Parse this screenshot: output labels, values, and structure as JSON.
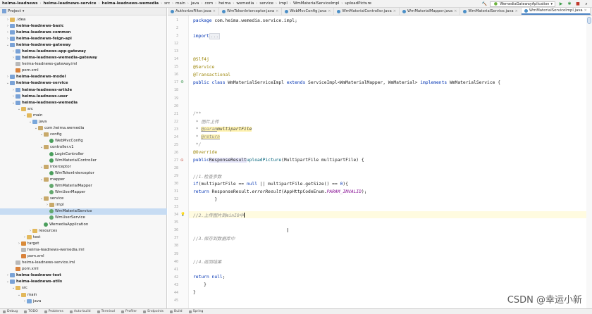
{
  "breadcrumb": [
    "heima-leadnews",
    "heima-leadnews-service",
    "heima-leadnews-wemedia",
    "src",
    "main",
    "java",
    "com",
    "heima",
    "wemedia",
    "service",
    "impl",
    "WmMaterialServiceImpl",
    "uploadPicture"
  ],
  "run_config": "WemediaGatewayAplication",
  "sidebar": {
    "title": "Project",
    "tree": [
      {
        "label": ".idea",
        "indent": 1,
        "arrow": "›",
        "icon": "folder",
        "bold": false
      },
      {
        "label": "heima-leadnews-basic",
        "indent": 1,
        "arrow": "›",
        "icon": "module",
        "bold": true
      },
      {
        "label": "heima-leadnews-common",
        "indent": 1,
        "arrow": "›",
        "icon": "module",
        "bold": true
      },
      {
        "label": "heima-leadnews-feign-api",
        "indent": 1,
        "arrow": "›",
        "icon": "module",
        "bold": true
      },
      {
        "label": "heima-leadnews-gateway",
        "indent": 1,
        "arrow": "⌄",
        "icon": "module",
        "bold": true
      },
      {
        "label": "heima-leadnews-app-gateway",
        "indent": 2,
        "arrow": "›",
        "icon": "module",
        "bold": true
      },
      {
        "label": "heima-leadnews-wemedia-gateway",
        "indent": 2,
        "arrow": "›",
        "icon": "module",
        "bold": true
      },
      {
        "label": "heima-leadnews-gateway.iml",
        "indent": 2,
        "arrow": "",
        "icon": "file",
        "bold": false
      },
      {
        "label": "pom.xml",
        "indent": 2,
        "arrow": "",
        "icon": "xml",
        "bold": false
      },
      {
        "label": "heima-leadnews-model",
        "indent": 1,
        "arrow": "›",
        "icon": "module",
        "bold": true
      },
      {
        "label": "heima-leadnews-service",
        "indent": 1,
        "arrow": "⌄",
        "icon": "module",
        "bold": true
      },
      {
        "label": "heima-leadnews-article",
        "indent": 2,
        "arrow": "›",
        "icon": "module",
        "bold": true
      },
      {
        "label": "heima-leadnews-user",
        "indent": 2,
        "arrow": "›",
        "icon": "module",
        "bold": true
      },
      {
        "label": "heima-leadnews-wemedia",
        "indent": 2,
        "arrow": "⌄",
        "icon": "module",
        "bold": true
      },
      {
        "label": "src",
        "indent": 3,
        "arrow": "⌄",
        "icon": "folder",
        "bold": false
      },
      {
        "label": "main",
        "indent": 4,
        "arrow": "⌄",
        "icon": "folder",
        "bold": false
      },
      {
        "label": "java",
        "indent": 5,
        "arrow": "⌄",
        "icon": "src",
        "bold": false
      },
      {
        "label": "com.heima.wemedia",
        "indent": 6,
        "arrow": "⌄",
        "icon": "pkg",
        "bold": false
      },
      {
        "label": "config",
        "indent": 7,
        "arrow": "⌄",
        "icon": "pkg",
        "bold": false
      },
      {
        "label": "WebMvcConfig",
        "indent": 8,
        "arrow": "",
        "icon": "java",
        "bold": false
      },
      {
        "label": "controller.v1",
        "indent": 7,
        "arrow": "⌄",
        "icon": "pkg",
        "bold": false
      },
      {
        "label": "LoginController",
        "indent": 8,
        "arrow": "",
        "icon": "java",
        "bold": false
      },
      {
        "label": "WmMaterialController",
        "indent": 8,
        "arrow": "",
        "icon": "java",
        "bold": false
      },
      {
        "label": "interceptor",
        "indent": 7,
        "arrow": "⌄",
        "icon": "pkg",
        "bold": false
      },
      {
        "label": "WmTokenInterceptor",
        "indent": 8,
        "arrow": "",
        "icon": "java",
        "bold": false
      },
      {
        "label": "mapper",
        "indent": 7,
        "arrow": "⌄",
        "icon": "pkg",
        "bold": false
      },
      {
        "label": "WmMaterialMapper",
        "indent": 8,
        "arrow": "",
        "icon": "iface",
        "bold": false
      },
      {
        "label": "WmUserMapper",
        "indent": 8,
        "arrow": "",
        "icon": "iface",
        "bold": false
      },
      {
        "label": "service",
        "indent": 7,
        "arrow": "⌄",
        "icon": "pkg",
        "bold": false
      },
      {
        "label": "impl",
        "indent": 8,
        "arrow": "›",
        "icon": "pkg",
        "bold": false
      },
      {
        "label": "WmMaterialService",
        "indent": 8,
        "arrow": "",
        "icon": "iface",
        "bold": false,
        "selected": true
      },
      {
        "label": "WmUserService",
        "indent": 8,
        "arrow": "",
        "icon": "iface",
        "bold": false
      },
      {
        "label": "WemediaApplication",
        "indent": 7,
        "arrow": "",
        "icon": "java",
        "bold": false
      },
      {
        "label": "resources",
        "indent": 5,
        "arrow": "›",
        "icon": "folder",
        "bold": false
      },
      {
        "label": "test",
        "indent": 4,
        "arrow": "›",
        "icon": "folder",
        "bold": false
      },
      {
        "label": "target",
        "indent": 3,
        "arrow": "›",
        "icon": "target",
        "bold": false
      },
      {
        "label": "heima-leadnews-wemedia.iml",
        "indent": 3,
        "arrow": "",
        "icon": "file",
        "bold": false
      },
      {
        "label": "pom.xml",
        "indent": 3,
        "arrow": "",
        "icon": "xml",
        "bold": false
      },
      {
        "label": "heima-leadnews-service.iml",
        "indent": 2,
        "arrow": "",
        "icon": "file",
        "bold": false
      },
      {
        "label": "pom.xml",
        "indent": 2,
        "arrow": "",
        "icon": "xml",
        "bold": false
      },
      {
        "label": "heima-leadnews-test",
        "indent": 1,
        "arrow": "›",
        "icon": "module",
        "bold": true
      },
      {
        "label": "heima-leadnews-utils",
        "indent": 1,
        "arrow": "⌄",
        "icon": "module",
        "bold": true
      },
      {
        "label": "src",
        "indent": 2,
        "arrow": "⌄",
        "icon": "folder",
        "bold": false
      },
      {
        "label": "main",
        "indent": 3,
        "arrow": "⌄",
        "icon": "folder",
        "bold": false
      },
      {
        "label": "java",
        "indent": 4,
        "arrow": "›",
        "icon": "src",
        "bold": false
      }
    ]
  },
  "tabs": [
    {
      "label": "AuthorizeFilter.java",
      "active": false
    },
    {
      "label": "WmTokenInterceptor.java",
      "active": false
    },
    {
      "label": "WebMvcConfig.java",
      "active": false
    },
    {
      "label": "WmMaterialController.java",
      "active": false
    },
    {
      "label": "WmMaterialMapper.java",
      "active": false
    },
    {
      "label": "WmMaterialService.java",
      "active": false
    },
    {
      "label": "WmMaterialServiceImpl.java",
      "active": true
    }
  ],
  "editor": {
    "lines": [
      {
        "n": "1",
        "html": "<span class='kw'>package</span> com.heima.wemedia.service.impl;"
      },
      {
        "n": "2",
        "html": ""
      },
      {
        "n": "3",
        "html": "<span class='kw'>import</span> <span class='fold'>...</span>"
      },
      {
        "n": "12",
        "html": ""
      },
      {
        "n": "13",
        "html": ""
      },
      {
        "n": "14",
        "html": "<span class='ann'>@Slf4j</span>"
      },
      {
        "n": "15",
        "html": "<span class='ann'>@Service</span>"
      },
      {
        "n": "16",
        "html": "<span class='ann'>@Transactional</span>"
      },
      {
        "n": "17",
        "html": "<span class='kw'>public class</span> WmMaterialServiceImpl <span class='kw'>extends</span> ServiceImpl&lt;WmMaterialMapper, WmMaterial&gt; <span class='kw'>implements</span> WmMaterialService {",
        "mark": "⚙",
        "markColor": "#4a9e5c"
      },
      {
        "n": "18",
        "html": ""
      },
      {
        "n": "19",
        "html": ""
      },
      {
        "n": "20",
        "html": ""
      },
      {
        "n": "21",
        "html": "    <span class='doc'>/**</span>"
      },
      {
        "n": "22",
        "html": "    <span class='doc'> * 图片上传</span>"
      },
      {
        "n": "23",
        "html": "    <span class='doc'> * </span><span class='doctag'>@param</span> <span class='docparam'>multipartFile</span>"
      },
      {
        "n": "24",
        "html": "    <span class='doc'> * </span><span class='doctag'>@return</span>"
      },
      {
        "n": "25",
        "html": "    <span class='doc'> */</span>"
      },
      {
        "n": "26",
        "html": "    <span class='ann'>@Override</span>"
      },
      {
        "n": "27",
        "html": "    <span class='kw'>public</span> <span class='type-hl'>ResponseResult</span> <span class='fn'>uploadPicture</span>(MultipartFile multipartFile) {",
        "mark": "⊙",
        "markColor": "#c0392b"
      },
      {
        "n": "28",
        "html": ""
      },
      {
        "n": "29",
        "html": "        <span class='cmt'>//1.检查参数</span>"
      },
      {
        "n": "30",
        "html": "        <span class='kw'>if</span>(multipartFile == <span class='kw'>null</span> || multipartFile.getSize() == <span class='kw'>0</span>){"
      },
      {
        "n": "31",
        "html": "            <span class='kw'>return</span> ResponseResult.<i>errorResult</i>(AppHttpCodeEnum.<span class='fld'>PARAM_INVALID</span>);"
      },
      {
        "n": "32",
        "html": "        }"
      },
      {
        "n": "33",
        "html": ""
      },
      {
        "n": "34",
        "html": "        <span class='cmt'>//2.上传图片到minIO中</span><span class='caret'></span>",
        "current": true,
        "mark": "💡",
        "markColor": "#e0a800"
      },
      {
        "n": "35",
        "html": ""
      },
      {
        "n": "36",
        "html": ""
      },
      {
        "n": "37",
        "html": "        <span class='cmt'>//3.保存到数据库中</span>"
      },
      {
        "n": "38",
        "html": ""
      },
      {
        "n": "39",
        "html": ""
      },
      {
        "n": "40",
        "html": "        <span class='cmt'>//4.返回结果</span>"
      },
      {
        "n": "41",
        "html": ""
      },
      {
        "n": "42",
        "html": "        <span class='kw'>return null</span>;"
      },
      {
        "n": "43",
        "html": "    }"
      },
      {
        "n": "44",
        "html": "}"
      },
      {
        "n": "45",
        "html": ""
      }
    ]
  },
  "statusbar": [
    "Debug",
    "TODO",
    "Problems",
    "Auto-build",
    "Terminal",
    "Profiler",
    "Endpoints",
    "Build",
    "Spring"
  ],
  "watermark": "CSDN @幸运小新"
}
